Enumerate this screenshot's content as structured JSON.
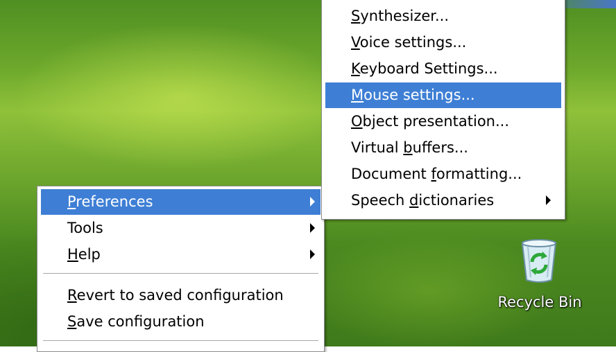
{
  "main_menu": {
    "items": [
      {
        "label": "Preferences",
        "mnemonic": "P",
        "rest": "references",
        "highlighted": true
      },
      {
        "label": "Tools"
      },
      {
        "label": "Help",
        "mnemonic": "H",
        "rest": "elp"
      },
      {
        "label": "Revert to saved configuration",
        "mnemonic": "R",
        "rest": "evert to saved configuration"
      },
      {
        "label": "Save configuration",
        "mnemonic": "S",
        "rest": "ave configuration"
      }
    ]
  },
  "submenu": {
    "items": [
      {
        "pre": "",
        "mnemonic": "S",
        "post": "ynthesizer..."
      },
      {
        "pre": "",
        "mnemonic": "V",
        "post": "oice settings..."
      },
      {
        "pre": "",
        "mnemonic": "K",
        "post": "eyboard Settings..."
      },
      {
        "pre": "",
        "mnemonic": "M",
        "post": "ouse settings...",
        "highlighted": true
      },
      {
        "pre": "",
        "mnemonic": "O",
        "post": "bject presentation..."
      },
      {
        "pre": "Virtual ",
        "mnemonic": "b",
        "post": "uffers..."
      },
      {
        "pre": "Document ",
        "mnemonic": "f",
        "post": "ormatting..."
      },
      {
        "pre": "Speech ",
        "mnemonic": "d",
        "post": "ictionaries"
      }
    ]
  },
  "desktop": {
    "recycle_bin_label": "Recycle Bin"
  },
  "colors": {
    "highlight": "#3e7fd5",
    "menu_bg": "#ffffff"
  },
  "icons": [
    "submenu-arrow-icon",
    "recycle-bin-icon"
  ]
}
